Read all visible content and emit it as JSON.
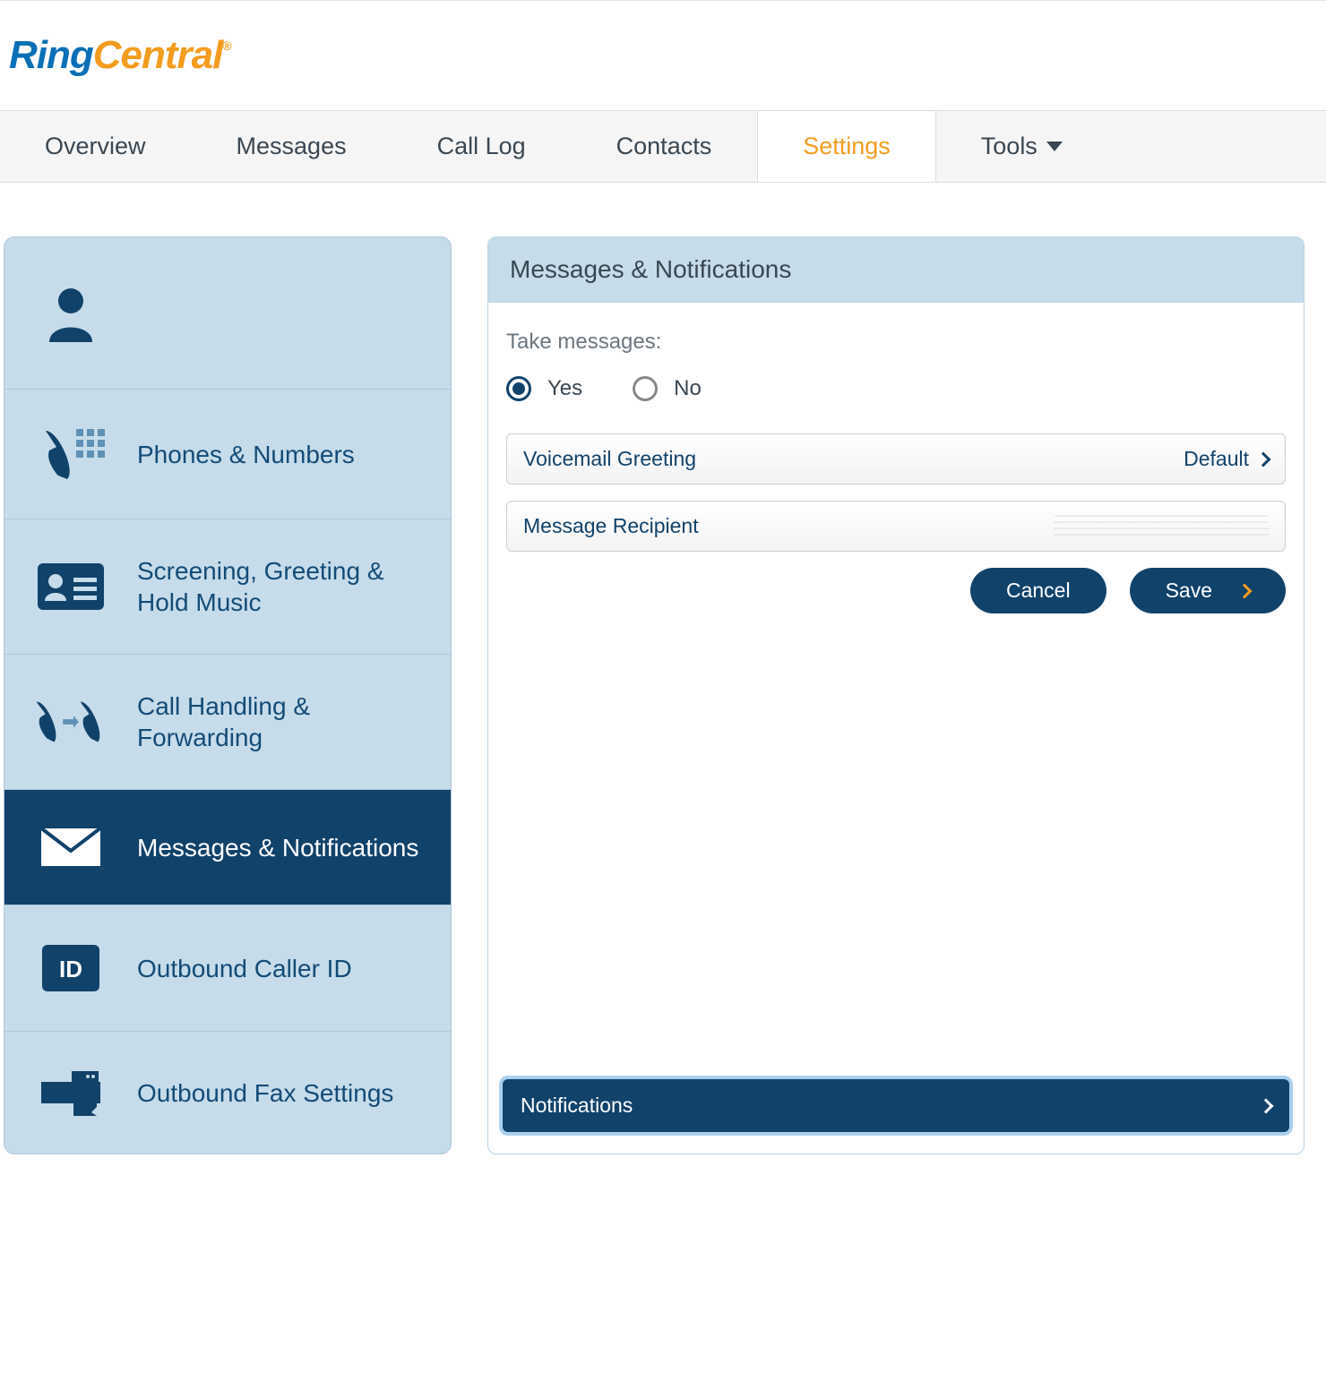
{
  "logo": {
    "part1": "Ring",
    "part2": "Central"
  },
  "nav": {
    "items": [
      {
        "label": "Overview"
      },
      {
        "label": "Messages"
      },
      {
        "label": "Call Log"
      },
      {
        "label": "Contacts"
      },
      {
        "label": "Settings"
      },
      {
        "label": "Tools"
      }
    ],
    "active_index": 4
  },
  "sidebar": {
    "items": [
      {
        "label": "",
        "icon": "user-icon"
      },
      {
        "label": "Phones & Numbers",
        "icon": "phone-keypad-icon"
      },
      {
        "label": "Screening, Greeting & Hold Music",
        "icon": "id-card-icon"
      },
      {
        "label": "Call Handling & Forwarding",
        "icon": "call-forward-icon"
      },
      {
        "label": "Messages & Notifications",
        "icon": "envelope-icon"
      },
      {
        "label": "Outbound Caller ID",
        "icon": "id-icon"
      },
      {
        "label": "Outbound Fax Settings",
        "icon": "fax-icon"
      }
    ],
    "selected_index": 4
  },
  "panel": {
    "title": "Messages & Notifications",
    "take_messages_label": "Take messages:",
    "radios": {
      "yes": "Yes",
      "no": "No",
      "selected": "yes"
    },
    "rows": [
      {
        "label": "Voicemail Greeting",
        "value": "Default"
      },
      {
        "label": "Message Recipient",
        "value": ""
      }
    ],
    "buttons": {
      "cancel": "Cancel",
      "save": "Save"
    },
    "footer_bar": "Notifications"
  }
}
